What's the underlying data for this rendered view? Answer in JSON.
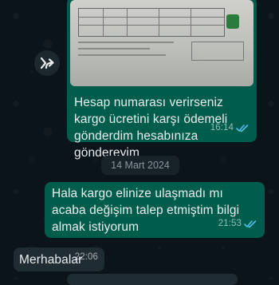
{
  "messages": [
    {
      "direction": "outgoing",
      "type": "image",
      "caption": "Hesap numarası verirseniz kargo ücretini karşı ödemeli gönderdim hesabınıza göndereyim",
      "time": "16:14",
      "status": "read"
    },
    {
      "direction": "outgoing",
      "type": "text",
      "text": "Hala kargo elinize ulaşmadı mı acaba değişim talep etmiştim bilgi almak istiyorum",
      "time": "21:53",
      "status": "read"
    },
    {
      "direction": "incoming",
      "type": "text",
      "text": "Merhabalar",
      "time": "22:06"
    }
  ],
  "date_separator": "14 Mart 2024",
  "icons": {
    "forward": "forward-icon",
    "read_receipt": "double-check-icon"
  },
  "colors": {
    "background": "#0b141a",
    "outgoing_bubble": "#005c4b",
    "incoming_bubble": "#202c33",
    "read_ticks": "#53bdeb"
  }
}
